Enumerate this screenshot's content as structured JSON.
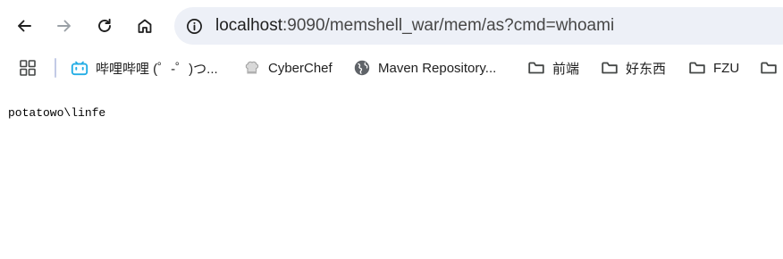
{
  "toolbar": {
    "back_icon": "arrow-left-icon",
    "forward_icon": "arrow-right-icon",
    "reload_icon": "reload-icon",
    "home_icon": "home-icon"
  },
  "address_bar": {
    "host": "localhost",
    "rest": ":9090/memshell_war/mem/as?cmd=whoami"
  },
  "bookmarks": [
    {
      "label": "哔哩哔哩 (゜-゜)つ...",
      "icon": "bilibili-icon"
    },
    {
      "label": "CyberChef",
      "icon": "cyberchef-icon"
    },
    {
      "label": "Maven Repository...",
      "icon": "globe-icon"
    },
    {
      "label": "前端",
      "icon": "folder-icon"
    },
    {
      "label": "好东西",
      "icon": "folder-icon"
    },
    {
      "label": "FZU",
      "icon": "folder-icon"
    }
  ],
  "page": {
    "output": "potatowo\\linfe"
  }
}
